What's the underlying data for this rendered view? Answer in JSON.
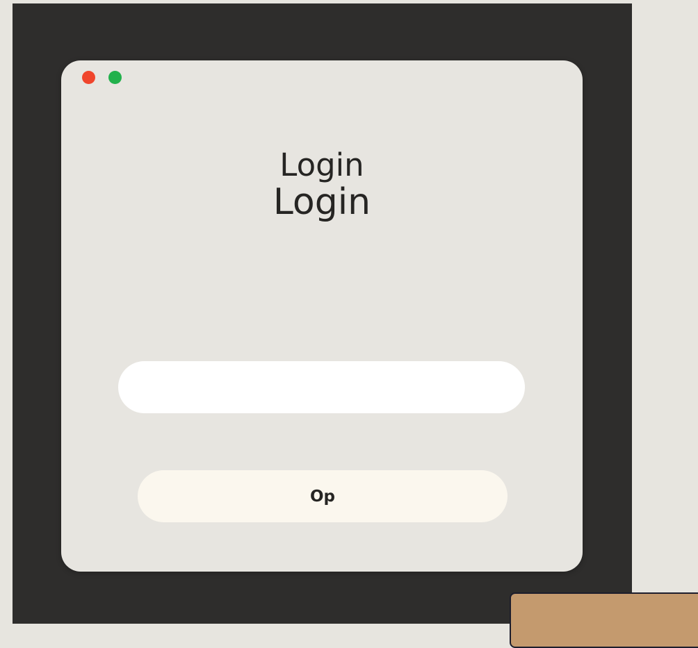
{
  "window": {
    "controls": {
      "close_color": "#f0452c",
      "zoom_color": "#22b14c",
      "close_icon": "close-dot-icon",
      "zoom_icon": "zoom-dot-icon"
    },
    "title_line_1": "Login",
    "title_line_2": "Login"
  },
  "form": {
    "input_value": "",
    "input_placeholder": "",
    "submit_label": "Op"
  },
  "colors": {
    "desktop_background": "#e7e5df",
    "screen_background": "#2e2d2c",
    "window_background": "#e7e5e0",
    "button_background": "#fbf7ee",
    "corner_panel": "#c49a6e"
  }
}
